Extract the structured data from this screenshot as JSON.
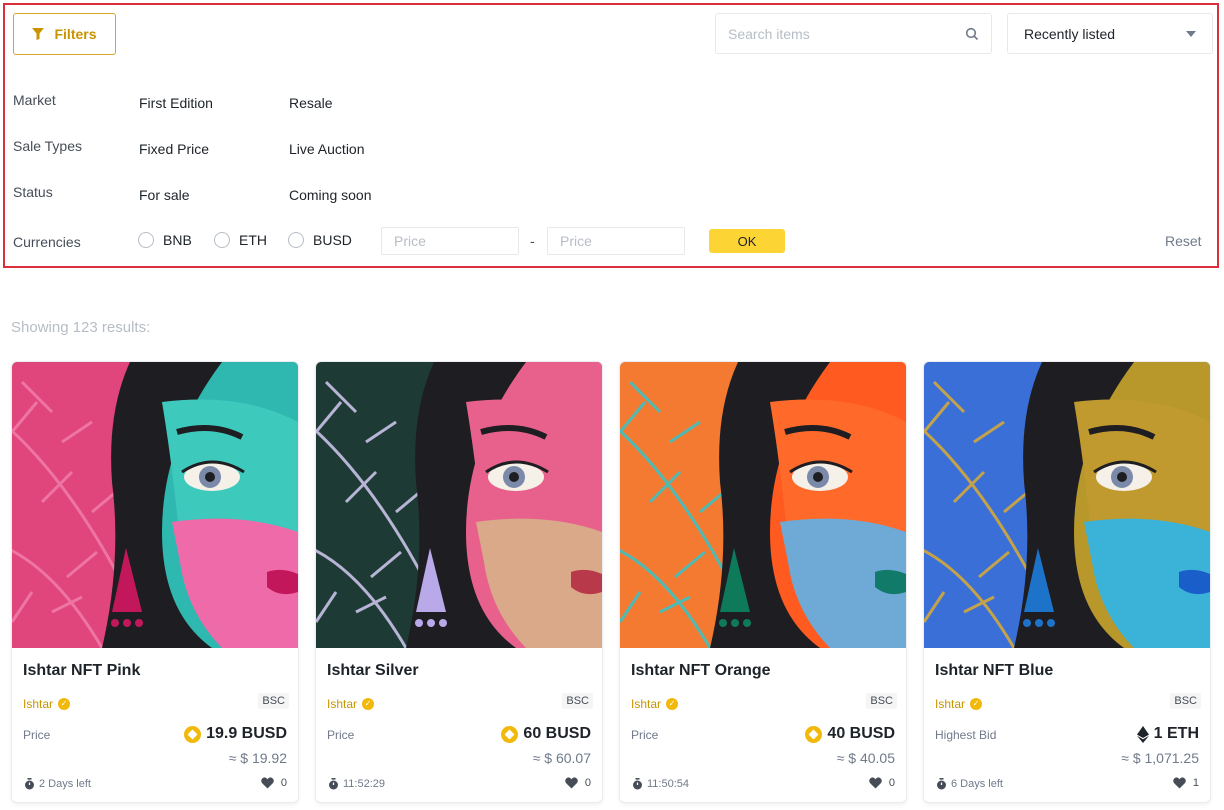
{
  "filters": {
    "button_label": "Filters",
    "search_placeholder": "Search items",
    "sort_value": "Recently listed",
    "market": {
      "label": "Market",
      "options": [
        "First Edition",
        "Resale"
      ]
    },
    "sale_types": {
      "label": "Sale Types",
      "options": [
        "Fixed Price",
        "Live Auction"
      ]
    },
    "status": {
      "label": "Status",
      "options": [
        "For sale",
        "Coming soon"
      ]
    },
    "currencies": {
      "label": "Currencies",
      "options": [
        "BNB",
        "ETH",
        "BUSD"
      ]
    },
    "price_min_placeholder": "Price",
    "price_max_placeholder": "Price",
    "separator": "-",
    "ok_label": "OK",
    "reset_label": "Reset"
  },
  "results_text": "Showing 123 results:",
  "cards": [
    {
      "title": "Ishtar NFT Pink",
      "creator": "Ishtar",
      "chain": "BSC",
      "price_label": "Price",
      "price": "19.9 BUSD",
      "currency_icon": "busd-icon",
      "usd": "≈ $ 19.92",
      "time": "2 Days left",
      "likes": "0",
      "palette": {
        "bg1": "#e0457b",
        "bg2": "#2fb8b0",
        "face": "#ef6aa8",
        "face2": "#3ec9bd",
        "leaf": "#f07aa8",
        "earring": "#c2185b",
        "lips": "#c2185b"
      }
    },
    {
      "title": "Ishtar Silver",
      "creator": "Ishtar",
      "chain": "BSC",
      "price_label": "Price",
      "price": "60 BUSD",
      "currency_icon": "busd-icon",
      "usd": "≈ $ 60.07",
      "time": "11:52:29",
      "likes": "0",
      "palette": {
        "bg1": "#1e3a34",
        "bg2": "#e8618c",
        "face": "#d9a98a",
        "face2": "#e8618c",
        "leaf": "#c8c2e8",
        "earring": "#b9a9e8",
        "lips": "#b83a4a"
      }
    },
    {
      "title": "Ishtar NFT Orange",
      "creator": "Ishtar",
      "chain": "BSC",
      "price_label": "Price",
      "price": "40 BUSD",
      "currency_icon": "busd-icon",
      "usd": "≈ $ 40.05",
      "time": "11:50:54",
      "likes": "0",
      "palette": {
        "bg1": "#f47a32",
        "bg2": "#ff5a1f",
        "face": "#6fa9d6",
        "face2": "#ff6a2a",
        "leaf": "#3ec2c2",
        "earring": "#0f7a5a",
        "lips": "#117a68"
      }
    },
    {
      "title": "Ishtar NFT Blue",
      "creator": "Ishtar",
      "chain": "BSC",
      "price_label": "Highest Bid",
      "price": "1 ETH",
      "currency_icon": "eth-icon",
      "usd": "≈ $ 1,071.25",
      "time": "6 Days left",
      "likes": "1",
      "palette": {
        "bg1": "#3a6fd8",
        "bg2": "#b8982a",
        "face": "#3bb3d9",
        "face2": "#c09a2e",
        "leaf": "#d4a83a",
        "earring": "#1d72c9",
        "lips": "#1a5fc9"
      }
    }
  ]
}
